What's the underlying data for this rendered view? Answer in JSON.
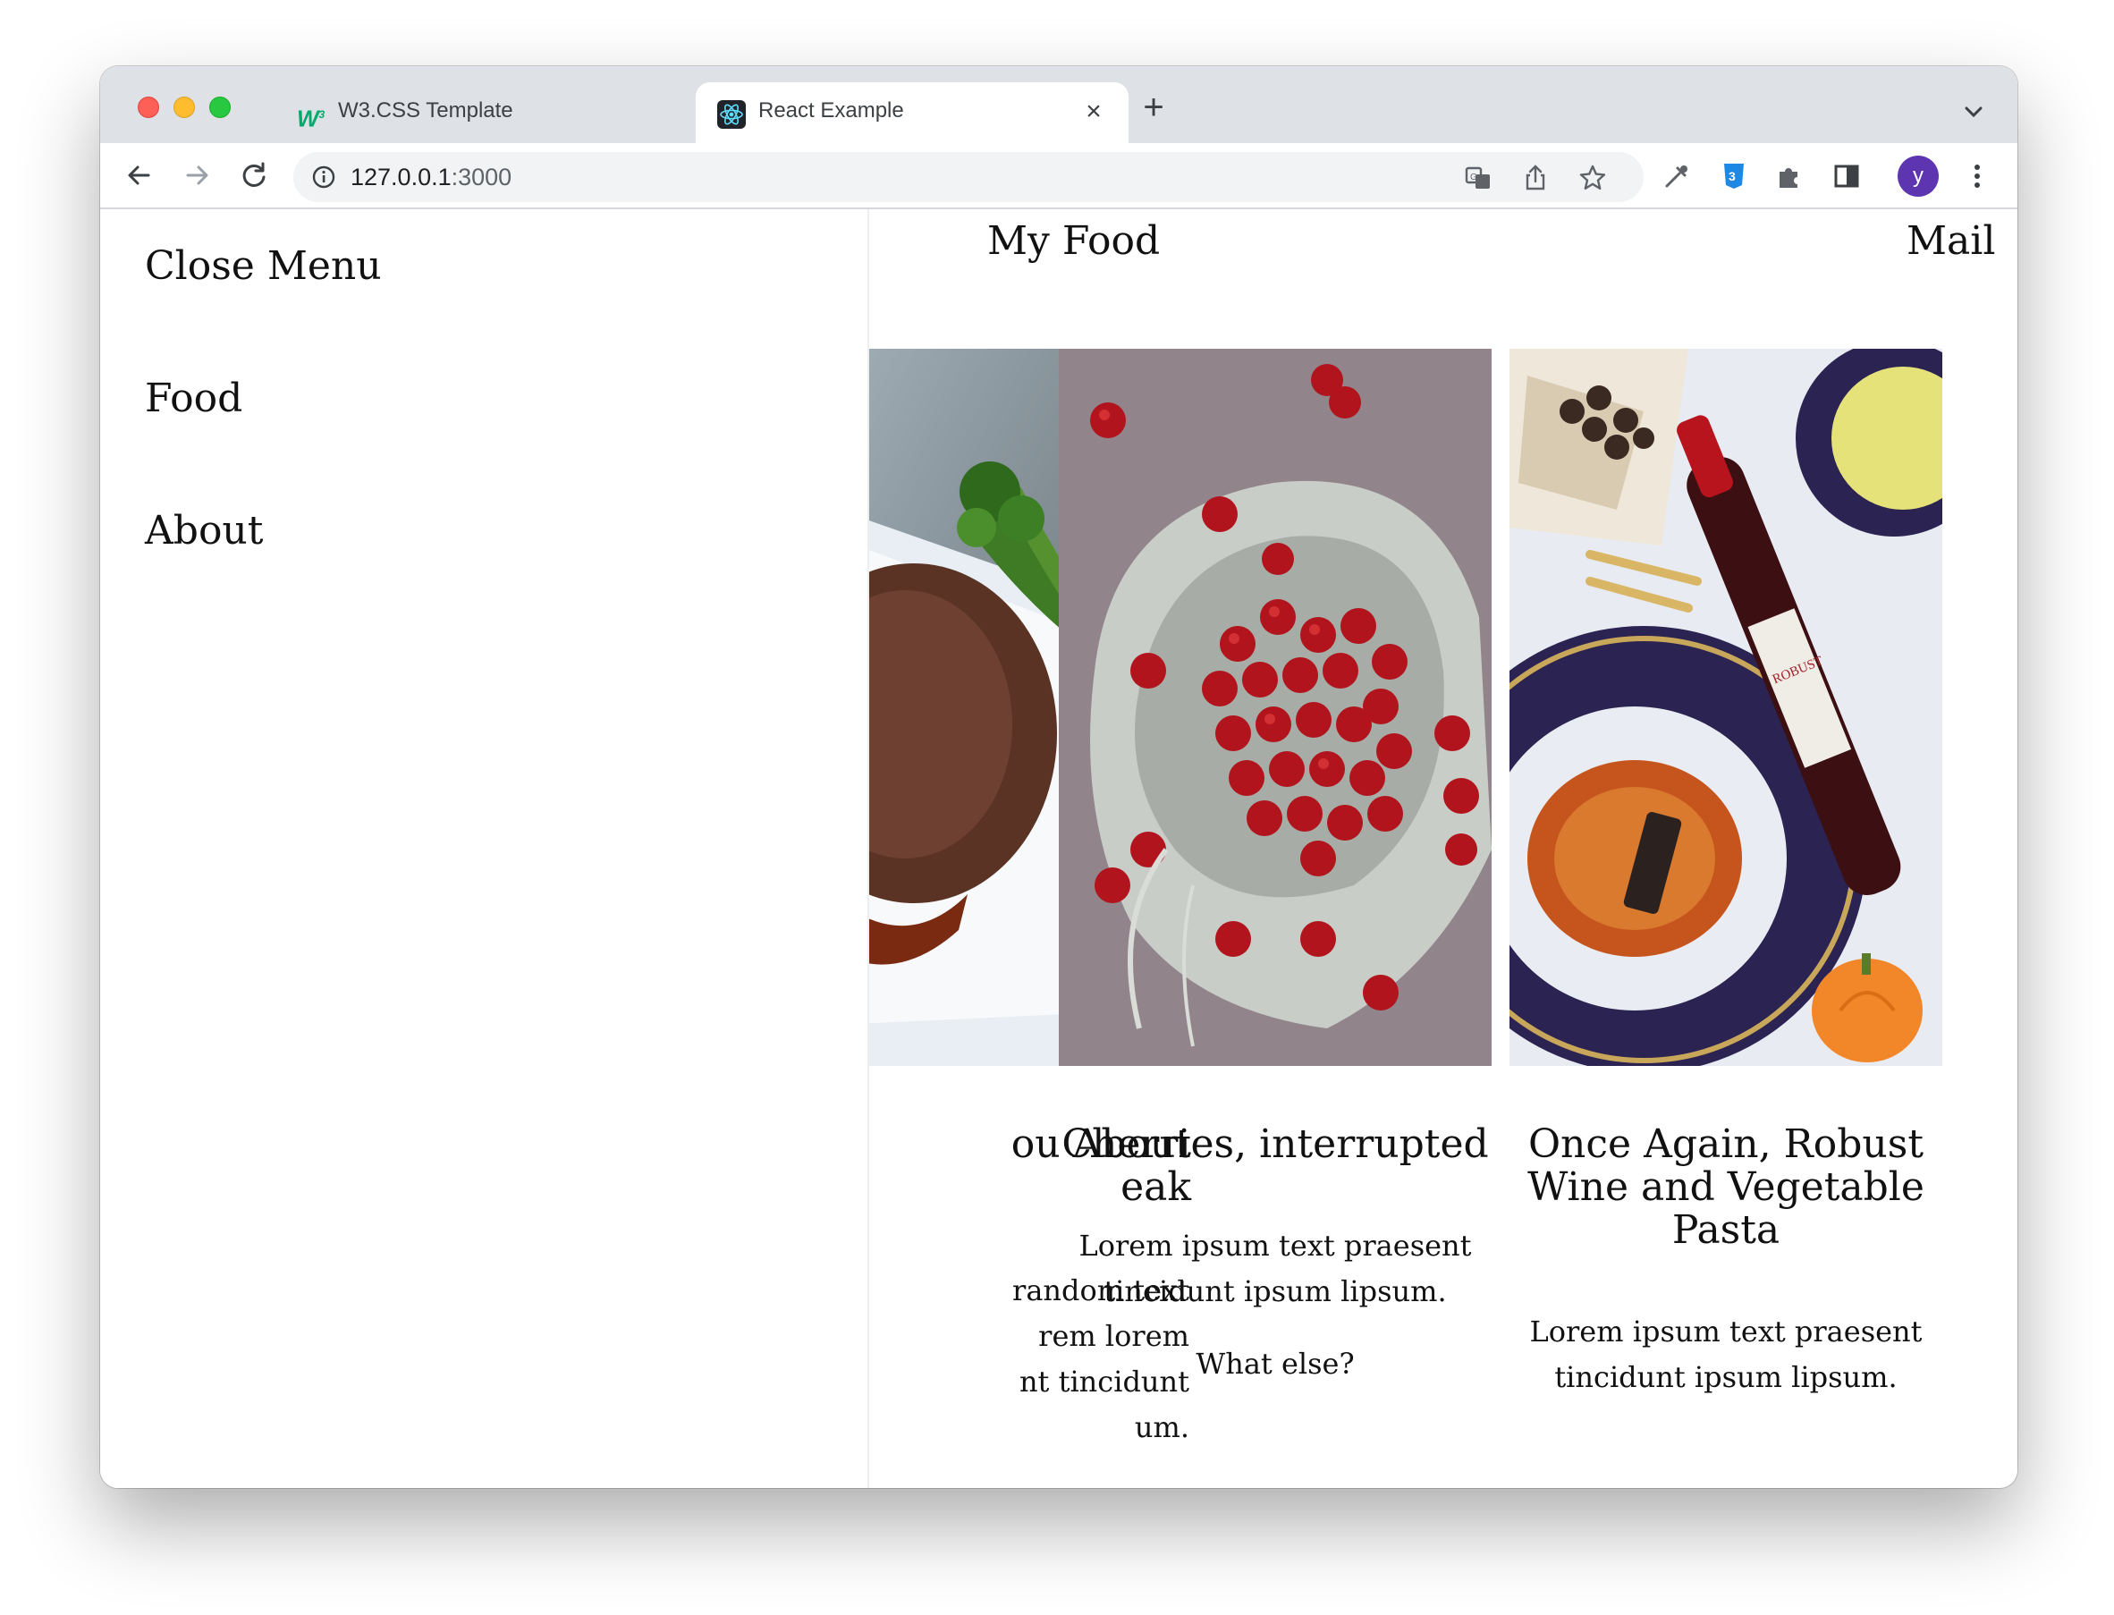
{
  "browser": {
    "tabs": [
      {
        "title": "W3.CSS Template",
        "favicon": "w3schools-icon"
      },
      {
        "title": "React Example",
        "favicon": "react-icon",
        "active": true
      }
    ],
    "address": {
      "host": "127.0.0.1",
      "port": ":3000"
    },
    "profile_initial": "y",
    "accent": "#5e35b1"
  },
  "sidebar": {
    "items": [
      {
        "label": "Close Menu"
      },
      {
        "label": "Food"
      },
      {
        "label": "About"
      }
    ]
  },
  "header": {
    "title": "My Food",
    "mail": "Mail"
  },
  "cards": [
    {
      "title": "ou About\neak",
      "text": "random text\nrem lorem\nnt tincidunt\num.",
      "image": "steak-with-broccolini-photo"
    },
    {
      "title": "Cherries, interrupted",
      "text": "Lorem ipsum text praesent tincidunt ipsum lipsum.",
      "extra": "What else?",
      "image": "cherries-in-cloth-photo"
    },
    {
      "title": "Once Again, Robust Wine and Vegetable Pasta",
      "text": "Lorem ipsum text praesent tincidunt ipsum lipsum.",
      "image": "wine-and-pasta-photo",
      "wine_label": "ROBUST"
    }
  ]
}
